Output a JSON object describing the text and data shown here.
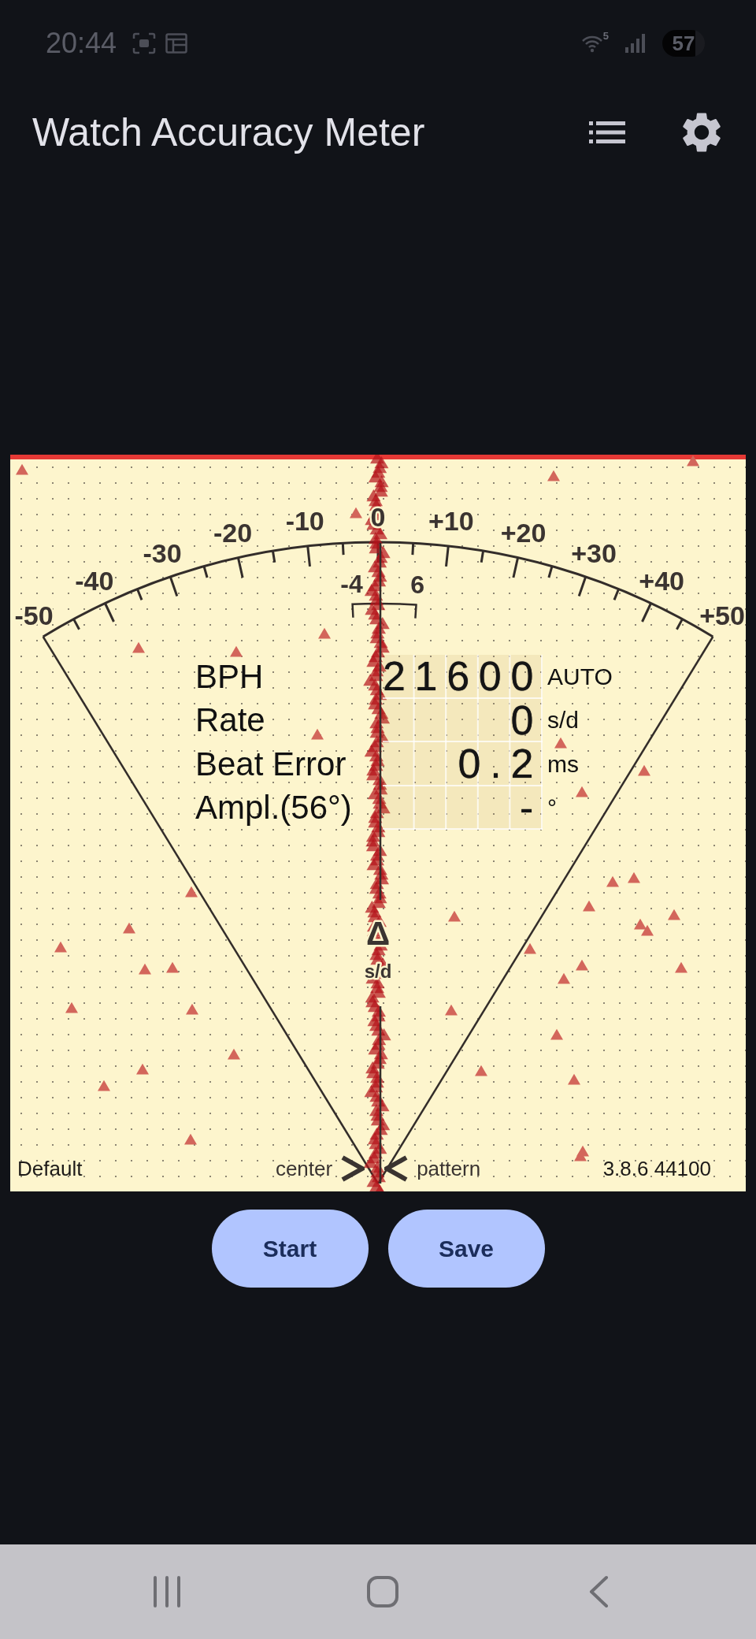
{
  "status_bar": {
    "time": "20:44",
    "wifi_label": "5",
    "battery": "57"
  },
  "app_bar": {
    "title": "Watch Accuracy Meter"
  },
  "meter": {
    "scale_labels": [
      "-50",
      "-40",
      "-30",
      "-20",
      "-10",
      "0",
      "+10",
      "+20",
      "+30",
      "+40",
      "+50"
    ],
    "range_labels": [
      "-4",
      "6"
    ],
    "delta_symbol": "Δ",
    "delta_unit": "s/d",
    "readings": [
      {
        "label": "BPH",
        "value": "21600",
        "unit": "AUTO"
      },
      {
        "label": "Rate",
        "value": "0",
        "unit": "s/d"
      },
      {
        "label": "Beat Error",
        "value": "0.2",
        "unit": "ms"
      },
      {
        "label": "Ampl.(56°)",
        "value": "-",
        "unit": "°"
      }
    ],
    "footer": {
      "profile": "Default",
      "left_caption": "center",
      "right_caption": "pattern",
      "version": "3.8.6 44100"
    }
  },
  "buttons": [
    {
      "label": "Start"
    },
    {
      "label": "Save"
    }
  ]
}
